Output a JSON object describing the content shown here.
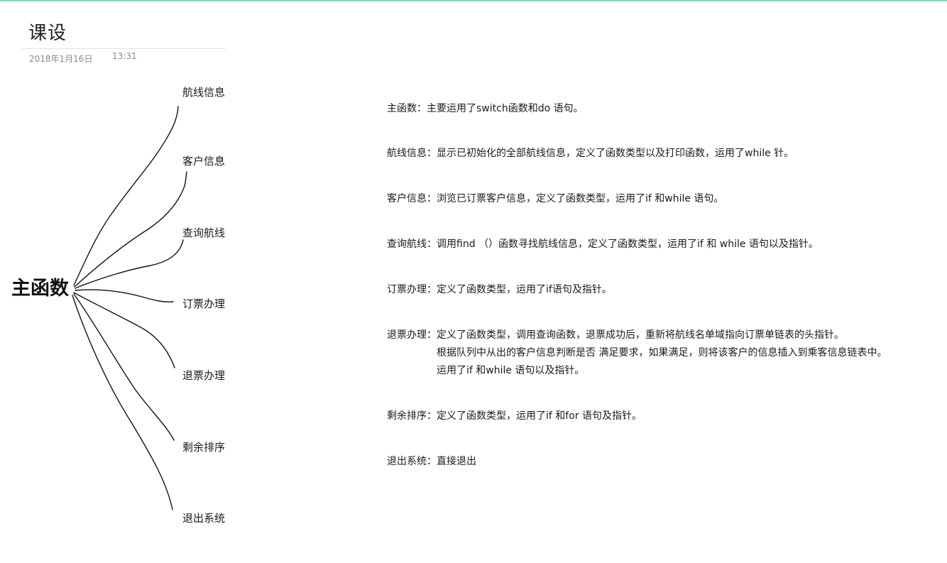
{
  "header": {
    "title": "课设",
    "date": "2018年1月16日",
    "time": "13:31"
  },
  "mindmap": {
    "center": "主函数",
    "branches": [
      "航线信息",
      "客户信息",
      "查询航线",
      "订票办理",
      "退票办理",
      "剩余排序",
      "退出系统"
    ]
  },
  "descriptions": [
    {
      "lines": [
        "主函数：主要运用了switch函数和do 语句。"
      ]
    },
    {
      "lines": [
        "航线信息：显示已初始化的全部航线信息，定义了函数类型以及打印函数，运用了while 针。"
      ]
    },
    {
      "lines": [
        "客户信息：浏览已订票客户信息，定义了函数类型，运用了if 和while 语句。"
      ]
    },
    {
      "lines": [
        "查询航线：调用find （）函数寻找航线信息，定义了函数类型，运用了if 和 while 语句以及指针。"
      ]
    },
    {
      "lines": [
        "订票办理：定义了函数类型，运用了if语句及指针。"
      ]
    },
    {
      "lines": [
        "退票办理：定义了函数类型，调用查询函数，退票成功后，重新将航线名单域指向订票单链表的头指针。",
        "根据队列中从出的客户信息判断是否    满足要求，如果满足，则将该客户的信息插入到乘客信息链表中。",
        "运用了if 和while 语句以及指针。"
      ]
    },
    {
      "lines": [
        "剩余排序：定义了函数类型，运用了if 和for 语句及指针。"
      ]
    },
    {
      "lines": [
        "退出系统：直接退出"
      ]
    }
  ],
  "ink_color": "#111111"
}
